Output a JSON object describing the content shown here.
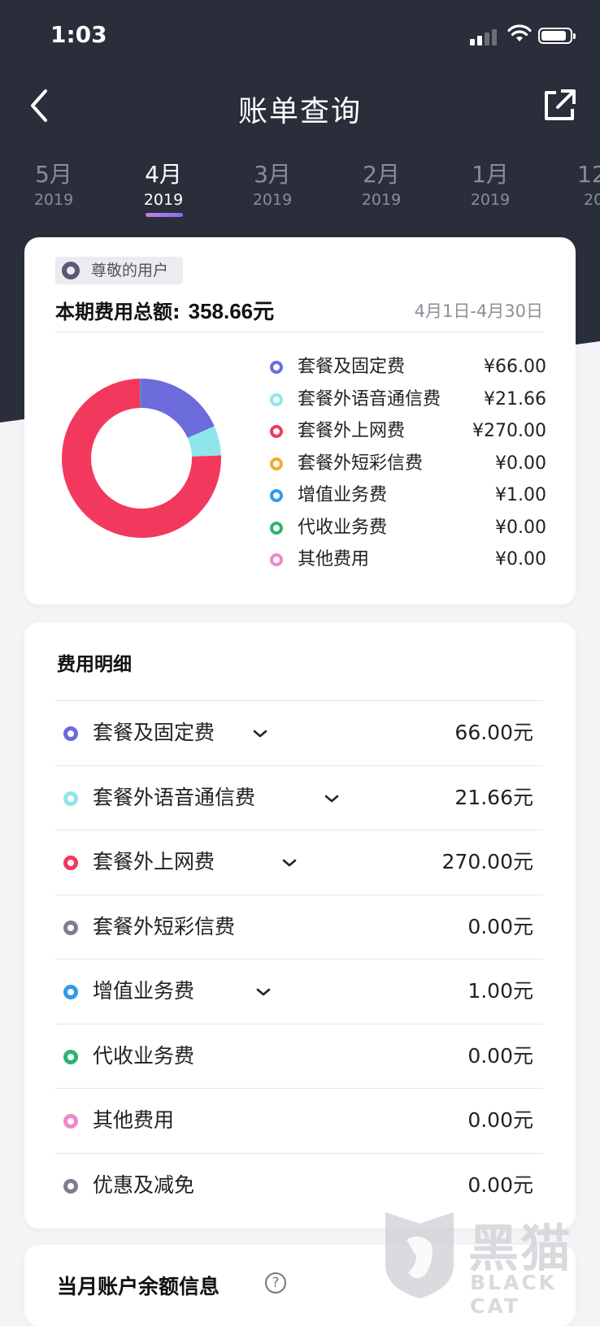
{
  "status_bar": {
    "time": "1:03"
  },
  "nav": {
    "title": "账单查询"
  },
  "months": [
    {
      "month": "5月",
      "year": "2019",
      "active": false
    },
    {
      "month": "4月",
      "year": "2019",
      "active": true
    },
    {
      "month": "3月",
      "year": "2019",
      "active": false
    },
    {
      "month": "2月",
      "year": "2019",
      "active": false
    },
    {
      "month": "1月",
      "year": "2019",
      "active": false
    },
    {
      "month": "12",
      "year": "20",
      "active": false
    }
  ],
  "summary": {
    "user_tag": "尊敬的用户",
    "total_label": "本期费用总额:",
    "total_amount": "358.66元",
    "period": "4月1日-4月30日"
  },
  "colors": {
    "package": "#6b6bdc",
    "voice": "#8fe6ea",
    "data": "#f3385d",
    "sms": "#f5ac2a",
    "value_added": "#2f9be9",
    "agency": "#29b56f",
    "other": "#ef88cc",
    "discount": "#7f7d92"
  },
  "legend": [
    {
      "name": "套餐及固定费",
      "value": "¥66.00",
      "color": "#6b6bdc"
    },
    {
      "name": "套餐外语音通信费",
      "value": "¥21.66",
      "color": "#8fe6ea"
    },
    {
      "name": "套餐外上网费",
      "value": "¥270.00",
      "color": "#f3385d"
    },
    {
      "name": "套餐外短彩信费",
      "value": "¥0.00",
      "color": "#f5ac2a"
    },
    {
      "name": "增值业务费",
      "value": "¥1.00",
      "color": "#2f9be9"
    },
    {
      "name": "代收业务费",
      "value": "¥0.00",
      "color": "#29b56f"
    },
    {
      "name": "其他费用",
      "value": "¥0.00",
      "color": "#ef88cc"
    }
  ],
  "donut_values": [
    66.0,
    21.66,
    270.0,
    0.0,
    1.0,
    0.0,
    0.0
  ],
  "details": {
    "title": "费用明细",
    "items": [
      {
        "name": "套餐及固定费",
        "value": "66.00元",
        "color": "#6b6bdc",
        "expandable": true
      },
      {
        "name": "套餐外语音通信费",
        "value": "21.66元",
        "color": "#8fe6ea",
        "expandable": true
      },
      {
        "name": "套餐外上网费",
        "value": "270.00元",
        "color": "#f3385d",
        "expandable": true
      },
      {
        "name": "套餐外短彩信费",
        "value": "0.00元",
        "color": "#7f7d92",
        "expandable": false
      },
      {
        "name": "增值业务费",
        "value": "1.00元",
        "color": "#2f9be9",
        "expandable": true
      },
      {
        "name": "代收业务费",
        "value": "0.00元",
        "color": "#29b56f",
        "expandable": false
      },
      {
        "name": "其他费用",
        "value": "0.00元",
        "color": "#ef88cc",
        "expandable": false
      },
      {
        "name": "优惠及减免",
        "value": "0.00元",
        "color": "#7f7d92",
        "expandable": false
      }
    ]
  },
  "balance": {
    "title": "当月账户余额信息",
    "help_icon": "?"
  },
  "watermark": {
    "text": "黑猫",
    "sub": "BLACK CAT"
  }
}
